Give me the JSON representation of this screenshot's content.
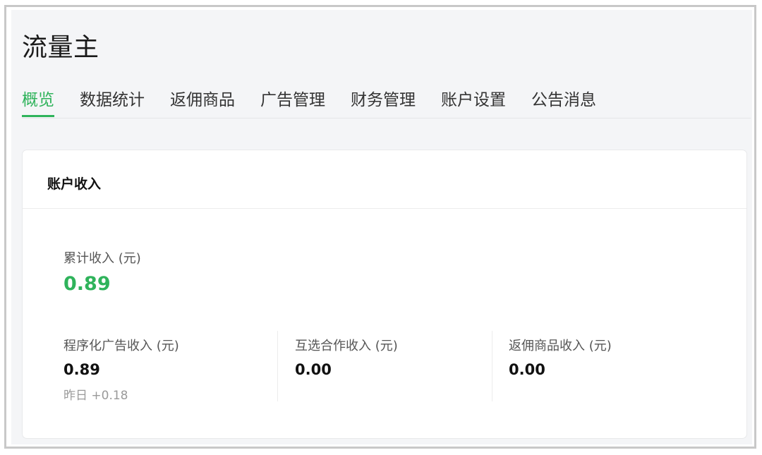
{
  "app": {
    "title": "流量主"
  },
  "tabs": [
    {
      "label": "概览",
      "active": true
    },
    {
      "label": "数据统计"
    },
    {
      "label": "返佣商品"
    },
    {
      "label": "广告管理"
    },
    {
      "label": "财务管理"
    },
    {
      "label": "账户设置"
    },
    {
      "label": "公告消息"
    }
  ],
  "account_income": {
    "title": "账户收入",
    "total": {
      "label": "累计收入 (元)",
      "value": "0.89"
    },
    "metrics": [
      {
        "label": "程序化广告收入 (元)",
        "value": "0.89",
        "sub": "昨日 +0.18"
      },
      {
        "label": "互选合作收入 (元)",
        "value": "0.00"
      },
      {
        "label": "返佣商品收入 (元)",
        "value": "0.00"
      }
    ]
  },
  "colors": {
    "accent": "#2fb35b",
    "panel_bg": "#f4f5f7"
  }
}
